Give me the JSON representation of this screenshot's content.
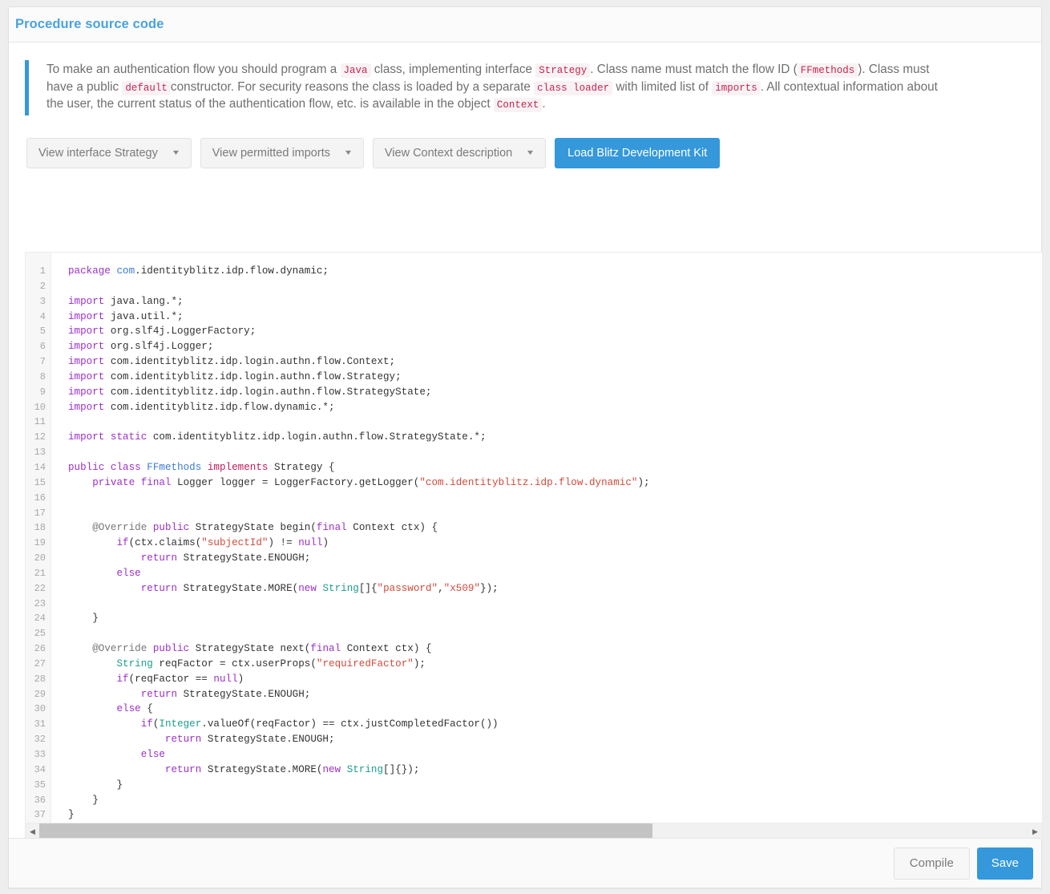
{
  "panel": {
    "title": "Procedure source code"
  },
  "callout": {
    "line1_a": "To make an authentication flow you should program a ",
    "code_java": "Java",
    "line1_b": " class, implementing interface ",
    "code_strategy": "Strategy",
    "line1_c": ". Class name must match the flow ID (",
    "code_ffmethods": "FFmethods",
    "line1_d": "). Class must have a public ",
    "code_default": "default",
    "line2_a": "constructor. For security reasons the class is loaded by a separate ",
    "code_classloader": "class loader",
    "line2_b": " with limited list of ",
    "code_imports": "imports",
    "line2_c": ". All contextual information about the user, the current status of the",
    "line3_a": "authentication flow, etc. is available in the object ",
    "code_context": "Context",
    "line3_b": "."
  },
  "toolbar": {
    "view_interface_strategy": "View interface Strategy",
    "view_permitted_imports": "View permitted imports",
    "view_context_description": "View Context description",
    "load_blitz_kit": "Load Blitz Development Kit",
    "caret_glyph": "▼"
  },
  "editor": {
    "line_numbers": [
      "1",
      "2",
      "3",
      "4",
      "5",
      "6",
      "7",
      "8",
      "9",
      "10",
      "11",
      "12",
      "13",
      "14",
      "15",
      "16",
      "17",
      "18",
      "19",
      "20",
      "21",
      "22",
      "23",
      "24",
      "25",
      "26",
      "27",
      "28",
      "29",
      "30",
      "31",
      "32",
      "33",
      "34",
      "35",
      "36",
      "37"
    ],
    "code_lines": [
      "package com.identityblitz.idp.flow.dynamic;",
      "",
      "import java.lang.*;",
      "import java.util.*;",
      "import org.slf4j.LoggerFactory;",
      "import org.slf4j.Logger;",
      "import com.identityblitz.idp.login.authn.flow.Context;",
      "import com.identityblitz.idp.login.authn.flow.Strategy;",
      "import com.identityblitz.idp.login.authn.flow.StrategyState;",
      "import com.identityblitz.idp.flow.dynamic.*;",
      "",
      "import static com.identityblitz.idp.login.authn.flow.StrategyState.*;",
      "",
      "public class FFmethods implements Strategy {",
      "    private final Logger logger = LoggerFactory.getLogger(\"com.identityblitz.idp.flow.dynamic\");",
      "",
      "",
      "    @Override public StrategyState begin(final Context ctx) {",
      "        if(ctx.claims(\"subjectId\") != null)",
      "            return StrategyState.ENOUGH;",
      "        else",
      "            return StrategyState.MORE(new String[]{\"password\",\"x509\"});",
      "",
      "    }",
      "",
      "    @Override public StrategyState next(final Context ctx) {",
      "        String reqFactor = ctx.userProps(\"requiredFactor\");",
      "        if(reqFactor == null)",
      "            return StrategyState.ENOUGH;",
      "        else {",
      "            if(Integer.valueOf(reqFactor) == ctx.justCompletedFactor())",
      "                return StrategyState.ENOUGH;",
      "            else",
      "                return StrategyState.MORE(new String[]{});",
      "        }",
      "    }",
      "}"
    ],
    "scrollbar": {
      "left_arrow": "◀",
      "right_arrow": "▶",
      "thumb_percent": 62
    }
  },
  "footer": {
    "compile_label": "Compile",
    "save_label": "Save"
  },
  "colors": {
    "accent": "#3498db",
    "title": "#4aa3df",
    "inline_code_text": "#c7254e",
    "inline_code_bg": "#f9f2f4",
    "keyword": "#9b30c9",
    "modifier": "#c2185b",
    "string": "#d14b3c",
    "type": "#1a9e8f",
    "classname": "#3a7bd5"
  }
}
